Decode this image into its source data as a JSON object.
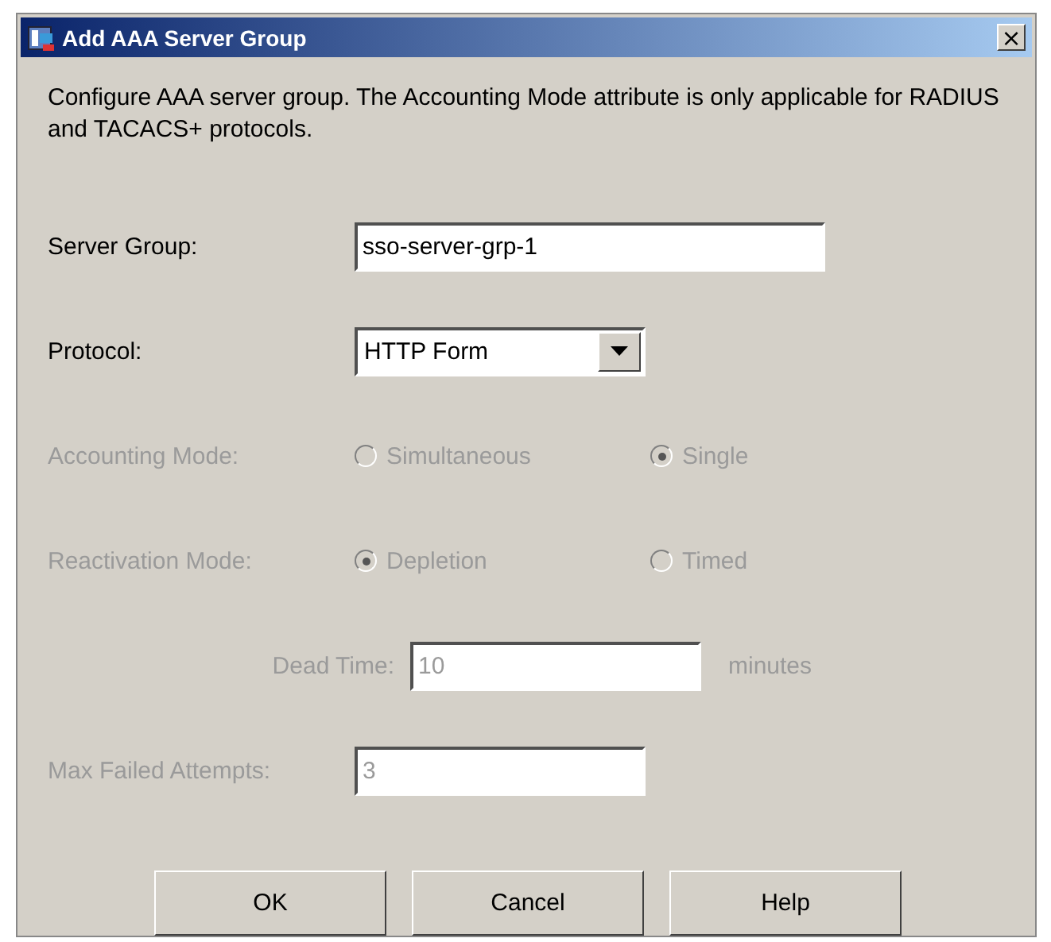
{
  "window": {
    "title": "Add AAA Server Group",
    "close": "×"
  },
  "description": "Configure AAA server group. The Accounting Mode attribute is only applicable for RADIUS and TACACS+ protocols.",
  "server_group": {
    "label": "Server Group:",
    "value": "sso-server-grp-1",
    "disabled": false
  },
  "protocol": {
    "label": "Protocol:",
    "value": "HTTP Form",
    "disabled": false
  },
  "accounting_mode": {
    "label": "Accounting Mode:",
    "disabled": true,
    "options": [
      {
        "label": "Simultaneous",
        "selected": false
      },
      {
        "label": "Single",
        "selected": true
      }
    ]
  },
  "reactivation_mode": {
    "label": "Reactivation Mode:",
    "disabled": true,
    "options": [
      {
        "label": "Depletion",
        "selected": true
      },
      {
        "label": "Timed",
        "selected": false
      }
    ]
  },
  "dead_time": {
    "label": "Dead Time:",
    "value": "10",
    "unit": "minutes",
    "disabled": true
  },
  "max_failed_attempts": {
    "label": "Max Failed Attempts:",
    "value": "3",
    "disabled": true
  },
  "buttons": [
    "OK",
    "Cancel",
    "Help"
  ]
}
